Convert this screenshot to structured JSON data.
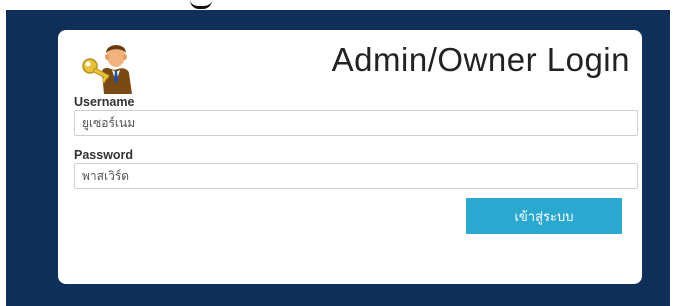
{
  "login": {
    "title": "Admin/Owner Login",
    "username_label": "Username",
    "username_placeholder": "ยูเซอร์เนม",
    "password_label": "Password",
    "password_placeholder": "พาสเวิร์ด",
    "submit_label": "เข้าสู่ระบบ"
  },
  "icons": {
    "header_icon": "admin-user-key-icon"
  },
  "colors": {
    "page_background": "#0f2f58",
    "card_background": "#ffffff",
    "button_background": "#2aa8cf",
    "button_text": "#ffffff"
  }
}
